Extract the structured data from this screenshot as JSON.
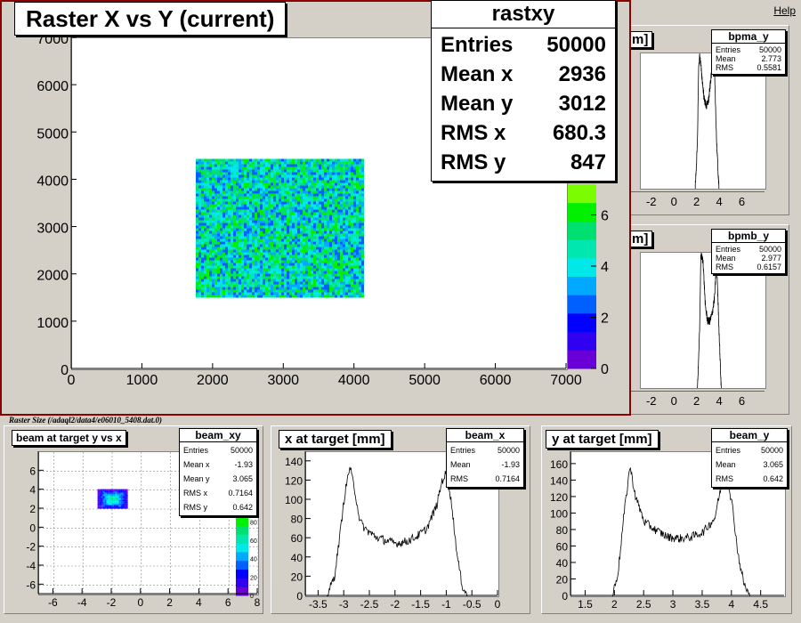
{
  "menu": {
    "help_label": "Help"
  },
  "footer_label": "Raster Size (/adaql2/data4/e06010_5408.dat.0)",
  "colors": {
    "pad": "#d4d0c8",
    "frame": "#8b0000",
    "palette": [
      "#6a00d8",
      "#3000f0",
      "#0000ff",
      "#0060ff",
      "#00a8ff",
      "#00e8e8",
      "#00e8b0",
      "#00e070",
      "#00f000",
      "#7cfc00"
    ]
  },
  "main_panel": {
    "title": "Raster X vs Y (current)",
    "stats": {
      "name": "rastxy",
      "rows": [
        {
          "label": "Entries",
          "value": "50000"
        },
        {
          "label": "Mean x",
          "value": "2936"
        },
        {
          "label": "Mean y",
          "value": "3012"
        },
        {
          "label": "RMS x",
          "value": "680.3"
        },
        {
          "label": "RMS y",
          "value": "847"
        }
      ]
    }
  },
  "bpma_panel": {
    "title_partial": "m]",
    "stats": {
      "name": "bpma_y",
      "rows": [
        {
          "label": "Entries",
          "value": "50000"
        },
        {
          "label": "Mean",
          "value": "2.773"
        },
        {
          "label": "RMS",
          "value": "0.5581"
        }
      ]
    }
  },
  "bpmb_panel": {
    "title_partial": "m]",
    "stats": {
      "name": "bpmb_y",
      "rows": [
        {
          "label": "Entries",
          "value": "50000"
        },
        {
          "label": "Mean",
          "value": "2.977"
        },
        {
          "label": "RMS",
          "value": "0.6157"
        }
      ]
    }
  },
  "beam_xy_panel": {
    "title": "beam at target y vs x",
    "stats": {
      "name": "beam_xy",
      "rows": [
        {
          "label": "Entries",
          "value": "50000"
        },
        {
          "label": "Mean x",
          "value": "-1.93"
        },
        {
          "label": "Mean y",
          "value": "3.065"
        },
        {
          "label": "RMS x",
          "value": "0.7164"
        },
        {
          "label": "RMS y",
          "value": "0.642"
        }
      ]
    }
  },
  "beam_x_panel": {
    "title": "x at target [mm]",
    "stats": {
      "name": "beam_x",
      "rows": [
        {
          "label": "Entries",
          "value": "50000"
        },
        {
          "label": "Mean",
          "value": "-1.93"
        },
        {
          "label": "RMS",
          "value": "0.7164"
        }
      ]
    }
  },
  "beam_y_panel": {
    "title": "y at target [mm]",
    "stats": {
      "name": "beam_y",
      "rows": [
        {
          "label": "Entries",
          "value": "50000"
        },
        {
          "label": "Mean",
          "value": "3.065"
        },
        {
          "label": "RMS",
          "value": "0.642"
        }
      ]
    }
  },
  "chart_data": [
    {
      "id": "rastxy",
      "type": "heatmap",
      "xlim": [
        0,
        7000
      ],
      "ylim": [
        0,
        7000
      ],
      "x_ticks": [
        0,
        1000,
        2000,
        3000,
        4000,
        5000,
        6000,
        7000
      ],
      "y_ticks": [
        0,
        1000,
        2000,
        3000,
        4000,
        5000,
        6000,
        7000
      ],
      "fill_region": {
        "x": [
          1750,
          4100
        ],
        "y": [
          1550,
          4450
        ]
      },
      "z_ticks": [
        0,
        2,
        4,
        6
      ],
      "grid": false
    },
    {
      "id": "bpma_y",
      "type": "line",
      "xlim": [
        -3,
        8
      ],
      "x_ticks": [
        -2,
        0,
        2,
        4,
        6
      ],
      "x": [
        1.8,
        2.0,
        2.1,
        2.2,
        2.4,
        2.6,
        2.8,
        3.0,
        3.2,
        3.4,
        3.5,
        3.7,
        3.9
      ],
      "y": [
        0,
        0.3,
        0.8,
        0.9,
        0.75,
        0.6,
        0.55,
        0.6,
        0.75,
        0.85,
        0.8,
        0.3,
        0
      ],
      "grid": false
    },
    {
      "id": "bpmb_y",
      "type": "line",
      "xlim": [
        -3,
        8
      ],
      "x_ticks": [
        -2,
        0,
        2,
        4,
        6
      ],
      "x": [
        2.0,
        2.2,
        2.3,
        2.5,
        2.7,
        2.9,
        3.1,
        3.3,
        3.5,
        3.7,
        3.9,
        4.1
      ],
      "y": [
        0,
        0.4,
        0.9,
        0.85,
        0.55,
        0.45,
        0.45,
        0.5,
        0.6,
        0.85,
        0.4,
        0
      ],
      "grid": false
    },
    {
      "id": "beam_xy",
      "type": "heatmap",
      "xlim": [
        -7,
        8
      ],
      "ylim": [
        -7,
        8
      ],
      "x_ticks": [
        -6,
        -4,
        -2,
        0,
        2,
        4,
        6,
        8
      ],
      "y_ticks": [
        -6,
        -4,
        -2,
        0,
        2,
        4,
        6
      ],
      "fill_region": {
        "x": [
          -3.0,
          -1.0
        ],
        "y": [
          2.1,
          4.1
        ]
      },
      "z_ticks": [
        0,
        20,
        40,
        60,
        80
      ],
      "grid": true
    },
    {
      "id": "beam_x",
      "type": "line",
      "xlim": [
        -3.75,
        0
      ],
      "ylim": [
        0,
        150
      ],
      "x_ticks": [
        -3.5,
        -3,
        -2.5,
        -2,
        -1.5,
        -1,
        -0.5,
        0
      ],
      "y_ticks": [
        0,
        20,
        40,
        60,
        80,
        100,
        120,
        140
      ],
      "x": [
        -3.35,
        -3.2,
        -3.1,
        -3.0,
        -2.9,
        -2.8,
        -2.7,
        -2.6,
        -2.4,
        -2.2,
        -2.0,
        -1.8,
        -1.6,
        -1.4,
        -1.2,
        -1.1,
        -1.0,
        -0.9,
        -0.8,
        -0.7,
        -0.6
      ],
      "y": [
        0,
        20,
        60,
        105,
        135,
        110,
        78,
        70,
        62,
        58,
        55,
        57,
        62,
        70,
        95,
        120,
        130,
        90,
        40,
        10,
        0
      ],
      "grid": false
    },
    {
      "id": "beam_y",
      "type": "line",
      "xlim": [
        1.25,
        4.9
      ],
      "ylim": [
        0,
        175
      ],
      "x_ticks": [
        1.5,
        2,
        2.5,
        3,
        3.5,
        4,
        4.5
      ],
      "y_ticks": [
        0,
        20,
        40,
        60,
        80,
        100,
        120,
        140,
        160
      ],
      "x": [
        1.95,
        2.05,
        2.15,
        2.25,
        2.35,
        2.5,
        2.7,
        2.9,
        3.1,
        3.3,
        3.5,
        3.7,
        3.8,
        3.9,
        4.0,
        4.1,
        4.2,
        4.3
      ],
      "y": [
        0,
        30,
        100,
        158,
        120,
        90,
        80,
        72,
        70,
        72,
        78,
        95,
        130,
        150,
        110,
        50,
        15,
        0
      ],
      "grid": false
    }
  ]
}
